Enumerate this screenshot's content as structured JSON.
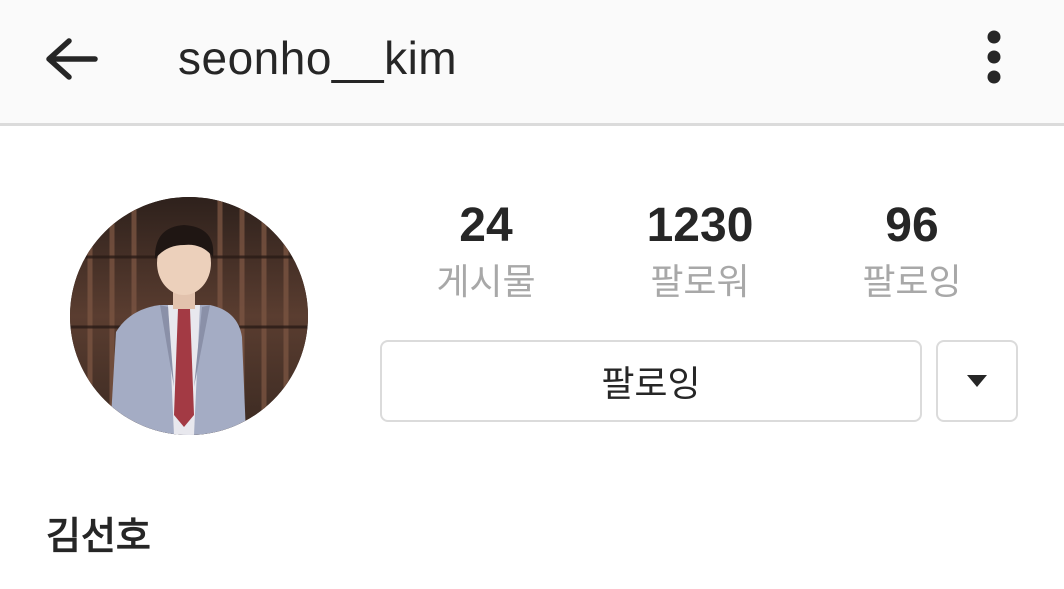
{
  "header": {
    "username": "seonho__kim",
    "back_icon": "arrow-left-icon",
    "more_icon": "vertical-dots-icon"
  },
  "profile": {
    "avatar_description": "profile-photo",
    "stats": [
      {
        "value": "24",
        "label": "게시물"
      },
      {
        "value": "1230",
        "label": "팔로워"
      },
      {
        "value": "96",
        "label": "팔로잉"
      }
    ],
    "follow_button_label": "팔로잉",
    "dropdown_icon": "triangle-down-icon",
    "full_name": "김선호"
  },
  "colors": {
    "text_primary": "#262626",
    "text_secondary": "#a8a8a8",
    "border": "#dbdbdb",
    "header_bg": "#fafafa"
  }
}
